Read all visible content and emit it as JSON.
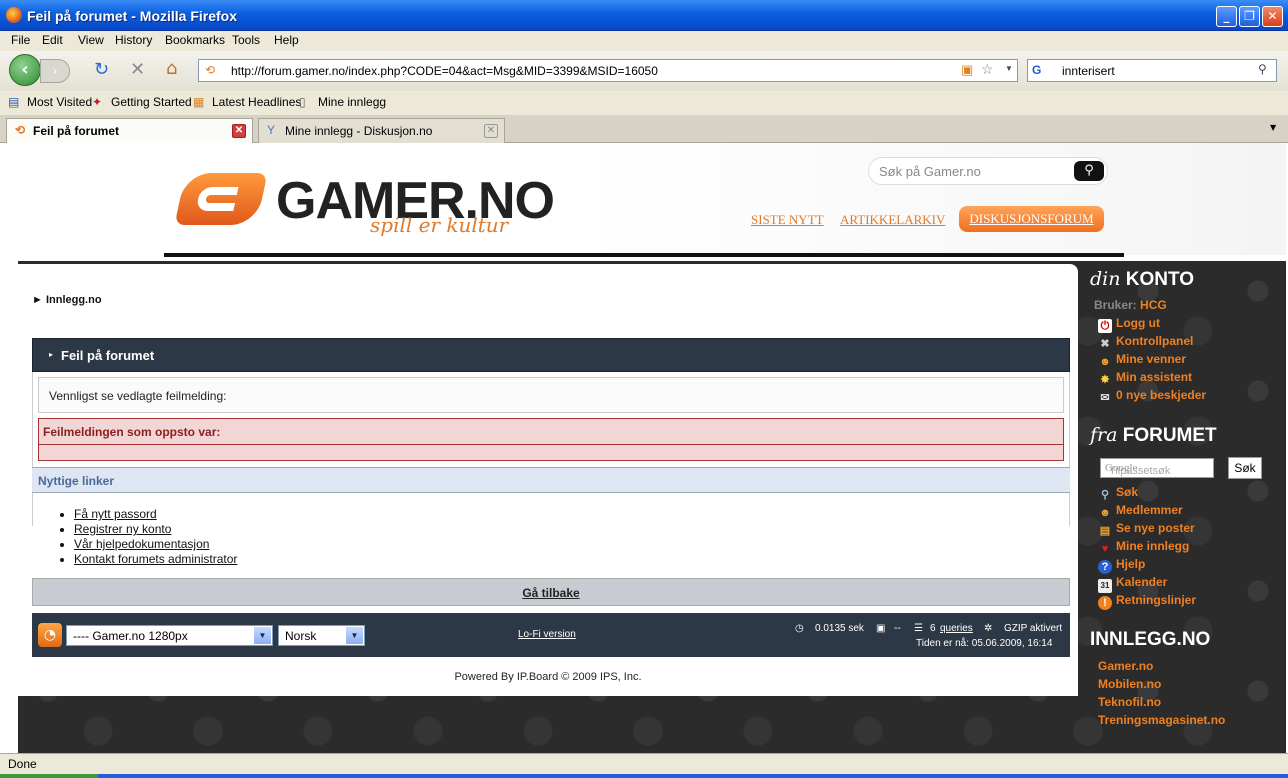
{
  "window": {
    "title": "Feil på forumet - Mozilla Firefox"
  },
  "menu": [
    "File",
    "Edit",
    "View",
    "History",
    "Bookmarks",
    "Tools",
    "Help"
  ],
  "address": {
    "url": "http://forum.gamer.no/index.php?CODE=04&act=Msg&MID=3399&MSID=16050"
  },
  "search_engine": {
    "value": "innterisert"
  },
  "bookmarks": [
    "Most Visited",
    "Getting Started",
    "Latest Headlines",
    "Mine innlegg"
  ],
  "tabs": [
    {
      "label": "Feil på forumet",
      "active": true
    },
    {
      "label": "Mine innlegg - Diskusjon.no",
      "active": false
    }
  ],
  "site": {
    "logo_text": "GAMER.NO",
    "logo_tagline": "spill er kultur",
    "search_placeholder": "Søk på Gamer.no",
    "nav": [
      "SISTE NYTT",
      "ARTIKKELARKIV",
      "DISKUSJONSFORUM"
    ]
  },
  "forum": {
    "breadcrumb": "Innlegg.no",
    "error_title": "Feil på forumet",
    "message": "Vennligst se vedlagte feilmelding:",
    "error_label": "Feilmeldingen som oppsto var:",
    "useful_links_title": "Nyttige linker",
    "useful_links": [
      "Få nytt passord",
      "Registrer ny konto",
      "Vår hjelpedokumentasjon",
      "Kontakt forumets administrator"
    ],
    "back_label": "Gå tilbake",
    "skin_select": "---- Gamer.no 1280px",
    "lang_select": "Norsk",
    "lofi": "Lo-Fi version",
    "stats": {
      "time": "0.0135 sek",
      "dash": "--",
      "queries_count": "6",
      "queries": "queries",
      "gzip": "GZIP aktivert",
      "clock": "Tiden er nå: 05.06.2009, 16:14"
    },
    "powered_by": "Powered By IP.Board © 2009  IPS, Inc."
  },
  "sidebar": {
    "konto_head_em": "din",
    "konto_head": "KONTO",
    "user_label": "Bruker:",
    "user_name": "HCG",
    "konto_items": [
      "Logg ut",
      "Kontrollpanel",
      "Mine venner",
      "Min assistent",
      "0 nye beskjeder"
    ],
    "forum_head_em": "fra",
    "forum_head": "FORUMET",
    "google_placeholder": "Tilpassetsøk",
    "google_logo": "Google",
    "search_button": "Søk",
    "forum_items": [
      "Søk",
      "Medlemmer",
      "Se nye poster",
      "Mine innlegg",
      "Hjelp",
      "Kalender",
      "Retningslinjer"
    ],
    "innlegg_head": "INNLEGG.NO",
    "sites": [
      "Gamer.no",
      "Mobilen.no",
      "Teknofil.no",
      "Treningsmagasinet.no"
    ]
  },
  "status": {
    "text": "Done"
  },
  "colors": {
    "accent": "#f08020",
    "header_bar": "#2d3846",
    "titlebar": "#0a5fe0"
  }
}
